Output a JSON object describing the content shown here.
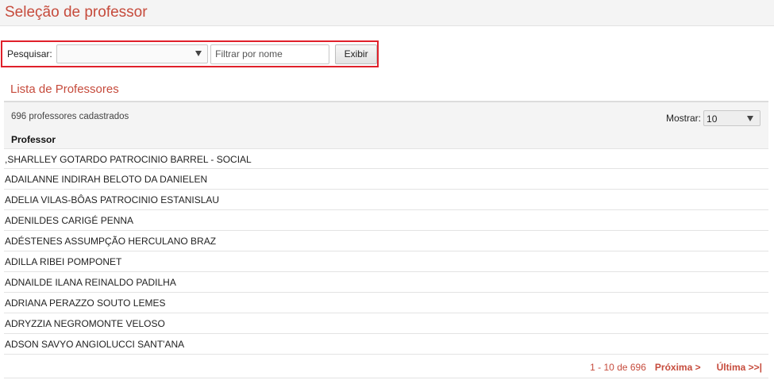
{
  "page": {
    "title": "Seleção de professor"
  },
  "filter": {
    "label": "Pesquisar:",
    "select_value": "",
    "name_placeholder": "Filtrar por nome",
    "button_label": "Exibir"
  },
  "list": {
    "title": "Lista de Professores",
    "count_text": "696 professores cadastrados",
    "show_label": "Mostrar:",
    "page_size": "10",
    "column_header": "Professor",
    "rows": [
      ",SHARLLEY GOTARDO PATROCINIO BARREL - SOCIAL",
      "ADAILANNE INDIRAH BELOTO DA DANIELEN",
      "ADELIA VILAS-BÔAS PATROCINIO ESTANISLAU",
      "ADENILDES CARIGÉ PENNA",
      "ADÉSTENES ASSUMPÇÃO HERCULANO BRAZ",
      "ADILLA RIBEI POMPONET",
      "ADNAILDE ILANA REINALDO PADILHA",
      "ADRIANA PERAZZO SOUTO LEMES",
      "ADRYZZIA NEGROMONTE VELOSO",
      "ADSON SAVYO ANGIOLUCCI SANT'ANA"
    ]
  },
  "pager": {
    "range": "1 - 10 de 696",
    "next": "Próxima >",
    "last": "Última >>|"
  },
  "colors": {
    "accent": "#c64b3c",
    "highlight_border": "#e0202a"
  }
}
